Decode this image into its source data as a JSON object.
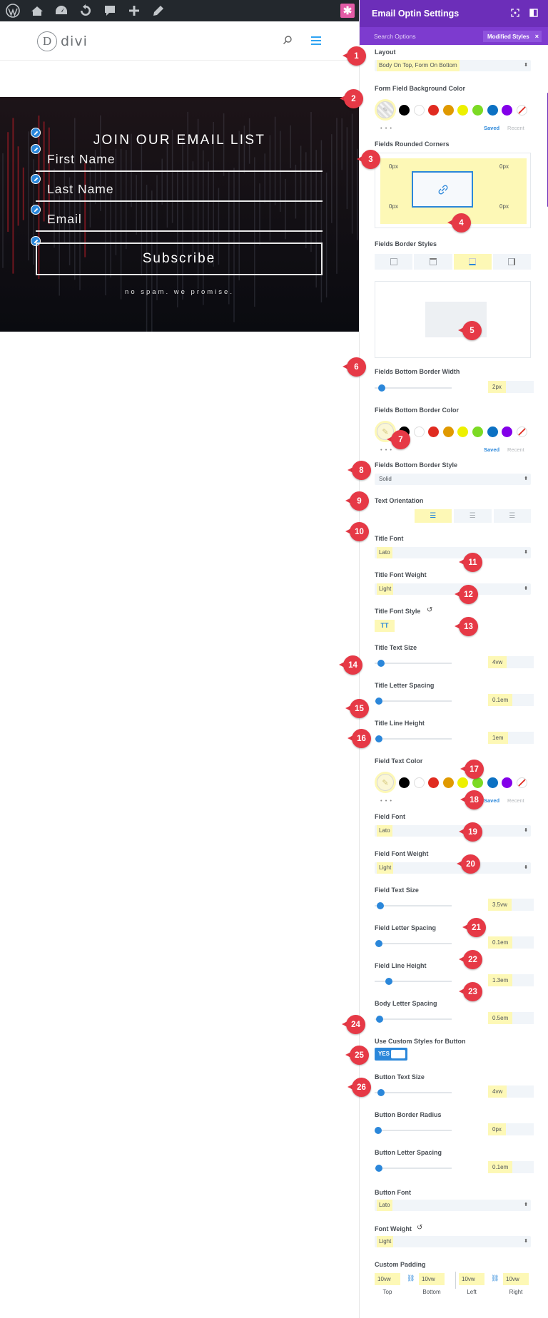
{
  "hero": {
    "title": "JOIN OUR EMAIL LIST",
    "fields": [
      "First Name",
      "Last Name",
      "Email"
    ],
    "button": "Subscribe",
    "footnote": "no spam. we promise."
  },
  "logo": {
    "mark": "D",
    "text": "divi"
  },
  "panel": {
    "title": "Email Optin Settings",
    "search_placeholder": "Search Options",
    "modified_label": "Modified Styles",
    "modified_close": "×",
    "layout": {
      "label": "Layout",
      "value": "Body On Top, Form On Bottom"
    },
    "form_bg_color": {
      "label": "Form Field Background Color"
    },
    "colors": [
      "#000000",
      "#ffffff",
      "#e02b20",
      "#e09900",
      "#edf000",
      "#7cda24",
      "#0c71c3",
      "#8300e9"
    ],
    "saved": "Saved",
    "recent": "Recent",
    "dots": "• • •",
    "rounded": {
      "label": "Fields Rounded Corners",
      "tl": "0px",
      "tr": "0px",
      "bl": "0px",
      "br": "0px"
    },
    "border_styles": {
      "label": "Fields Border Styles"
    },
    "bottom_border_width": {
      "label": "Fields Bottom Border Width",
      "value": "2px",
      "level": 0.05
    },
    "bottom_border_color": {
      "label": "Fields Bottom Border Color"
    },
    "bottom_border_style": {
      "label": "Fields Bottom Border Style",
      "value": "Solid"
    },
    "text_orientation": {
      "label": "Text Orientation"
    },
    "title_font": {
      "label": "Title Font",
      "value": "Lato"
    },
    "title_font_weight": {
      "label": "Title Font Weight",
      "value": "Light"
    },
    "title_font_style": {
      "label": "Title Font Style",
      "value": "TT"
    },
    "title_text_size": {
      "label": "Title Text Size",
      "value": "4vw",
      "level": 0.04
    },
    "title_letter_spacing": {
      "label": "Title Letter Spacing",
      "value": "0.1em",
      "level": 0.01
    },
    "title_line_height": {
      "label": "Title Line Height",
      "value": "1em",
      "level": 0.01
    },
    "field_text_color": {
      "label": "Field Text Color"
    },
    "field_font": {
      "label": "Field Font",
      "value": "Lato"
    },
    "field_font_weight": {
      "label": "Field Font Weight",
      "value": "Light"
    },
    "field_text_size": {
      "label": "Field Text Size",
      "value": "3.5vw",
      "level": 0.035
    },
    "field_letter_spacing": {
      "label": "Field Letter Spacing",
      "value": "0.1em",
      "level": 0.01
    },
    "field_line_height": {
      "label": "Field Line Height",
      "value": "1.3em",
      "level": 0.15
    },
    "body_letter_spacing": {
      "label": "Body Letter Spacing",
      "value": "0.5em",
      "level": 0.02
    },
    "custom_button": {
      "label": "Use Custom Styles for Button",
      "value": "YES"
    },
    "button_text_size": {
      "label": "Button Text Size",
      "value": "4vw",
      "level": 0.04
    },
    "button_border_radius": {
      "label": "Button Border Radius",
      "value": "0px",
      "level": 0.0
    },
    "button_letter_spacing": {
      "label": "Button Letter Spacing",
      "value": "0.1em",
      "level": 0.01
    },
    "button_font": {
      "label": "Button Font",
      "value": "Lato"
    },
    "font_weight": {
      "label": "Font Weight",
      "value": "Light"
    },
    "custom_padding": {
      "label": "Custom Padding",
      "top": "10vw",
      "bottom": "10vw",
      "left": "10vw",
      "right": "10vw",
      "top_lbl": "Top",
      "bottom_lbl": "Bottom",
      "left_lbl": "Left",
      "right_lbl": "Right"
    }
  },
  "markers": [
    "1",
    "2",
    "3",
    "4",
    "5",
    "6",
    "7",
    "8",
    "9",
    "10",
    "11",
    "12",
    "13",
    "14",
    "15",
    "16",
    "17",
    "18",
    "19",
    "20",
    "21",
    "22",
    "23",
    "24",
    "25",
    "26"
  ],
  "colors": {
    "accent": "#2b87da",
    "purple": "#6c2eb9",
    "marker": "#e63946",
    "highlight": "#fdf8b6"
  }
}
